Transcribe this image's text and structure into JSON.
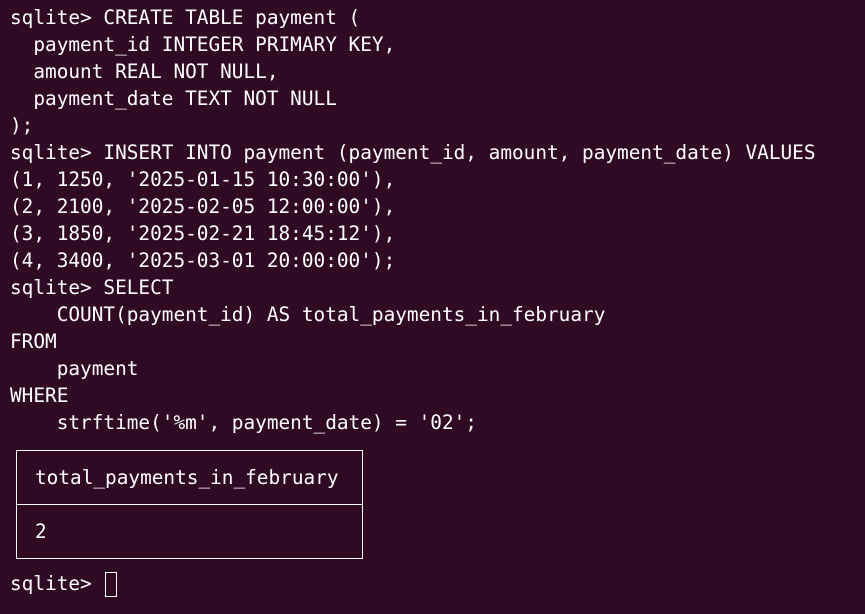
{
  "terminal": {
    "lines": [
      "sqlite> CREATE TABLE payment (",
      "  payment_id INTEGER PRIMARY KEY,",
      "  amount REAL NOT NULL,",
      "  payment_date TEXT NOT NULL",
      ");",
      "sqlite> INSERT INTO payment (payment_id, amount, payment_date) VALUES",
      "(1, 1250, '2025-01-15 10:30:00'),",
      "(2, 2100, '2025-02-05 12:00:00'),",
      "(3, 1850, '2025-02-21 18:45:12'),",
      "(4, 3400, '2025-03-01 20:00:00');",
      "sqlite> SELECT",
      "    COUNT(payment_id) AS total_payments_in_february",
      "FROM",
      "    payment",
      "WHERE",
      "    strftime('%m', payment_date) = '02';"
    ],
    "result": {
      "header": "total_payments_in_february",
      "value": "2"
    },
    "prompt": "sqlite> "
  },
  "colors": {
    "background": "#300a24",
    "foreground": "#ffffff"
  }
}
